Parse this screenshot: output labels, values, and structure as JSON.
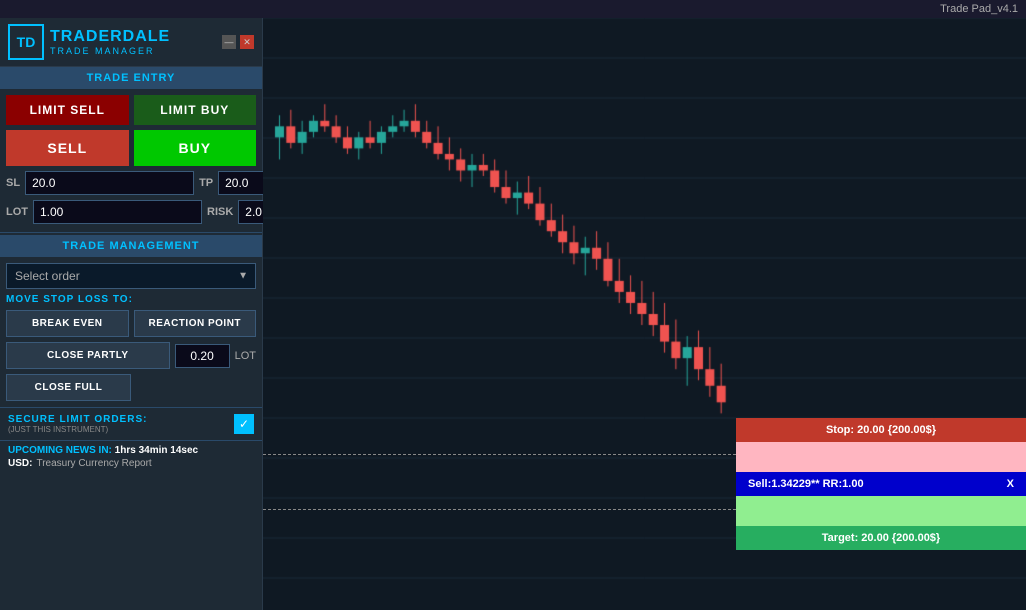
{
  "app": {
    "title": "Trade Pad_v4.1",
    "logo": {
      "icon": "TD",
      "name_part1": "TRADER",
      "name_part2": "DALE",
      "subtitle": "TRADE MANAGER"
    },
    "window_controls": {
      "minimize": "—",
      "close": "✕"
    }
  },
  "trade_entry": {
    "section_title": "TRADE ENTRY",
    "limit_sell_label": "LIMIT SELL",
    "limit_buy_label": "LIMIT BUY",
    "sell_label": "SELL",
    "buy_label": "BUY",
    "sl_label": "SL",
    "sl_value": "20.0",
    "tp_label": "TP",
    "tp_value": "20.0",
    "lot_label": "LOT",
    "lot_value": "1.00",
    "risk_label": "RISK",
    "risk_value": "2.0",
    "percent_label": "%"
  },
  "trade_management": {
    "section_title": "TRADE MANAGEMENT",
    "select_placeholder": "Select order",
    "move_stop_label": "MOVE STOP LOSS TO:",
    "break_even_label": "BREAK EVEN",
    "reaction_point_label": "REACTION POINT",
    "close_partly_label": "CLOSE PARTLY",
    "close_partly_lot": "0.20",
    "lot_label": "LOT",
    "close_full_label": "CLOSE FULL"
  },
  "secure": {
    "title": "SECURE LIMIT ORDERS:",
    "subtitle": "(JUST THIS INSTRUMENT)",
    "checked": true
  },
  "news": {
    "title_prefix": "UPCOMING NEWS IN:",
    "countdown": "1hrs 34min 14sec",
    "currency": "USD:",
    "description": "Treasury Currency Report"
  },
  "trade_overlay": {
    "stop_text": "Stop: 20.00 {200.00$}",
    "sell_text": "Sell:1.34229** RR:1.00",
    "close_x": "X",
    "target_text": "Target: 20.00 {200.00$}"
  },
  "colors": {
    "accent": "#00c0ff",
    "stop_bg": "#c0392b",
    "sell_bg": "#0000cc",
    "target_bg": "#27ae60",
    "pink_bg": "#ffb6c1",
    "light_green_bg": "#90ee90"
  }
}
